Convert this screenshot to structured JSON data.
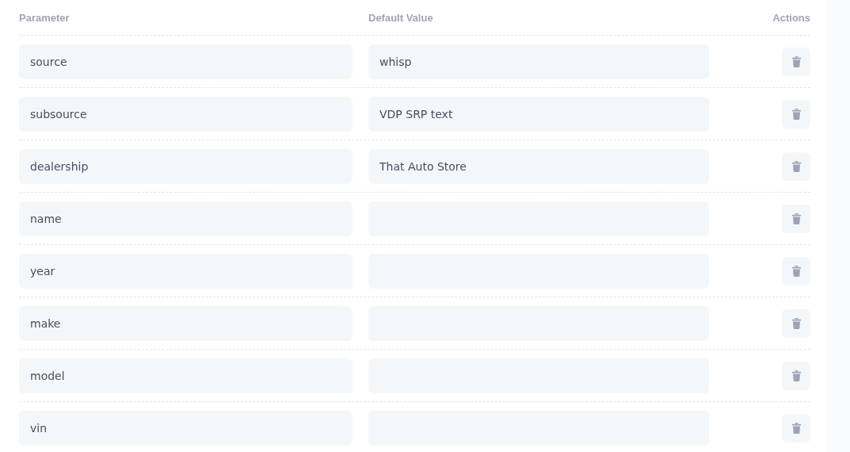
{
  "columns": [
    "Parameter",
    "Default Value",
    "Actions"
  ],
  "rows": [
    {
      "parameter": "source",
      "value": "whisp"
    },
    {
      "parameter": "subsource",
      "value": "VDP SRP text"
    },
    {
      "parameter": "dealership",
      "value": "That Auto Store"
    },
    {
      "parameter": "name",
      "value": ""
    },
    {
      "parameter": "year",
      "value": ""
    },
    {
      "parameter": "make",
      "value": ""
    },
    {
      "parameter": "model",
      "value": ""
    },
    {
      "parameter": "vin",
      "value": ""
    }
  ]
}
